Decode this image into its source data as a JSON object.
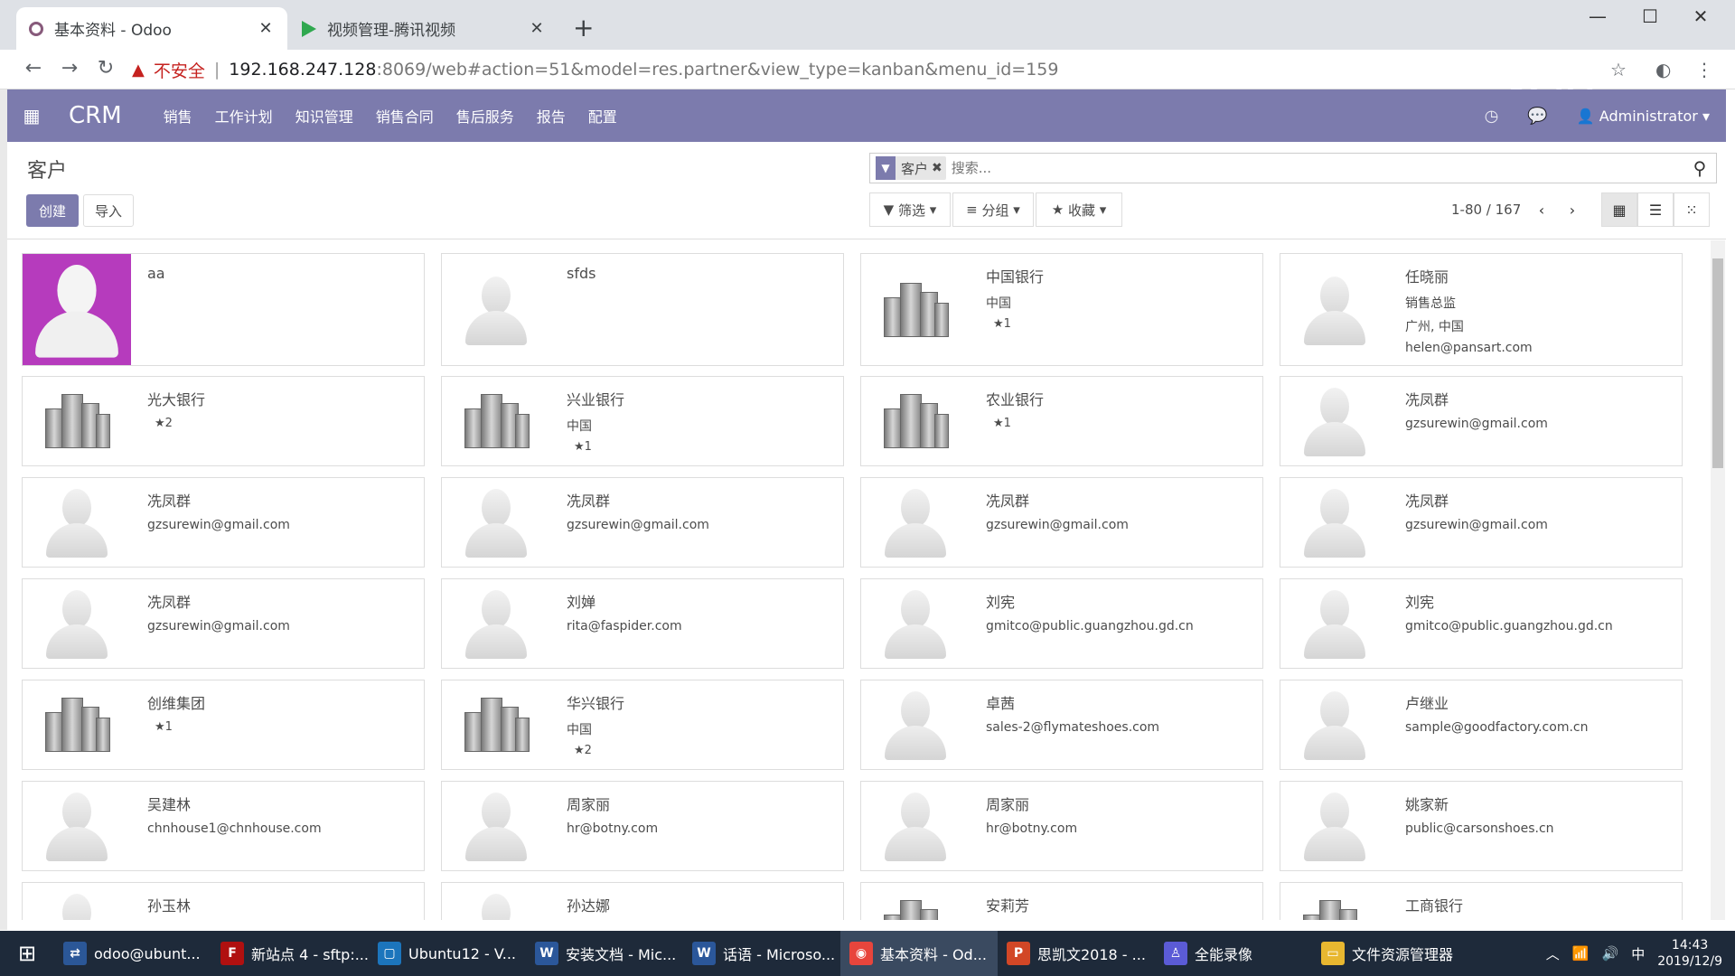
{
  "browser": {
    "tabs": [
      {
        "title": "基本资料 - Odoo",
        "close": "✕"
      },
      {
        "title": "视频管理-腾讯视频",
        "close": "✕"
      }
    ],
    "new_tab": "+",
    "security_warning": "不安全",
    "url_host": "192.168.247.128",
    "url_rest": ":8069/web#action=51&model=res.partner&view_type=kanban&menu_id=159",
    "watermark": "爱拍"
  },
  "app": {
    "brand": "CRM",
    "menu": [
      "销售",
      "工作计划",
      "知识管理",
      "销售合同",
      "售后服务",
      "报告",
      "配置"
    ],
    "user": "Administrator"
  },
  "control_panel": {
    "breadcrumb": "客户",
    "create_label": "创建",
    "import_label": "导入",
    "facet_label": "客户",
    "search_placeholder": "搜索...",
    "filter_label": "筛选",
    "group_label": "分组",
    "favorites_label": "收藏",
    "pager": "1-80 / 167"
  },
  "cards": [
    {
      "name": "aa",
      "lines": [],
      "type": "photo"
    },
    {
      "name": "sfds",
      "lines": [],
      "type": "person"
    },
    {
      "name": "中国银行",
      "lines": [
        "中国"
      ],
      "stars": "1",
      "type": "company"
    },
    {
      "name": "任晓丽",
      "lines": [
        "销售总监",
        "广州, 中国",
        "helen@pansart.com"
      ],
      "type": "person"
    },
    {
      "name": "光大银行",
      "lines": [],
      "stars": "2",
      "type": "company"
    },
    {
      "name": "兴业银行",
      "lines": [
        "中国"
      ],
      "stars": "1",
      "type": "company"
    },
    {
      "name": "农业银行",
      "lines": [],
      "stars": "1",
      "type": "company"
    },
    {
      "name": "冼凤群",
      "lines": [
        "gzsurewin@gmail.com"
      ],
      "type": "person"
    },
    {
      "name": "冼凤群",
      "lines": [
        "gzsurewin@gmail.com"
      ],
      "type": "person"
    },
    {
      "name": "冼凤群",
      "lines": [
        "gzsurewin@gmail.com"
      ],
      "type": "person"
    },
    {
      "name": "冼凤群",
      "lines": [
        "gzsurewin@gmail.com"
      ],
      "type": "person"
    },
    {
      "name": "冼凤群",
      "lines": [
        "gzsurewin@gmail.com"
      ],
      "type": "person"
    },
    {
      "name": "冼凤群",
      "lines": [
        "gzsurewin@gmail.com"
      ],
      "type": "person"
    },
    {
      "name": "刘婵",
      "lines": [
        "rita@faspider.com"
      ],
      "type": "person"
    },
    {
      "name": "刘宪",
      "lines": [
        "gmitco@public.guangzhou.gd.cn"
      ],
      "type": "person"
    },
    {
      "name": "刘宪",
      "lines": [
        "gmitco@public.guangzhou.gd.cn"
      ],
      "type": "person"
    },
    {
      "name": "创维集团",
      "lines": [],
      "stars": "1",
      "type": "company"
    },
    {
      "name": "华兴银行",
      "lines": [
        "中国"
      ],
      "stars": "2",
      "type": "company"
    },
    {
      "name": "卓茜",
      "lines": [
        "sales-2@flymateshoes.com"
      ],
      "type": "person"
    },
    {
      "name": "卢继业",
      "lines": [
        "sample@goodfactory.com.cn"
      ],
      "type": "person"
    },
    {
      "name": "吴建林",
      "lines": [
        "chnhouse1@chnhouse.com"
      ],
      "type": "person"
    },
    {
      "name": "周家丽",
      "lines": [
        "hr@botny.com"
      ],
      "type": "person"
    },
    {
      "name": "周家丽",
      "lines": [
        "hr@botny.com"
      ],
      "type": "person"
    },
    {
      "name": "姚家新",
      "lines": [
        "public@carsonshoes.cn"
      ],
      "type": "person"
    },
    {
      "name": "孙玉林",
      "lines": [],
      "type": "person"
    },
    {
      "name": "孙达娜",
      "lines": [],
      "type": "person"
    },
    {
      "name": "安莉芳",
      "lines": [],
      "type": "company"
    },
    {
      "name": "工商银行",
      "lines": [],
      "type": "company"
    }
  ],
  "taskbar": {
    "items": [
      {
        "label": "odoo@ubunt...",
        "color": "#2b5797",
        "glyph": "⇄"
      },
      {
        "label": "新站点 4 - sftp:...",
        "color": "#b01010",
        "glyph": "F"
      },
      {
        "label": "Ubuntu12 - V...",
        "color": "#1c75bc",
        "glyph": "▢"
      },
      {
        "label": "安装文档 - Mic...",
        "color": "#2b579a",
        "glyph": "W"
      },
      {
        "label": "话语 - Microso...",
        "color": "#2b579a",
        "glyph": "W"
      },
      {
        "label": "基本资料 - Od...",
        "color": "#e8453c",
        "glyph": "◉"
      },
      {
        "label": "思凯文2018 - ...",
        "color": "#d24726",
        "glyph": "P"
      },
      {
        "label": "全能录像",
        "color": "#5b5bd6",
        "glyph": "♙"
      },
      {
        "label": "文件资源管理器",
        "color": "#e8b730",
        "glyph": "▭"
      }
    ],
    "ime": "中",
    "time": "14:43",
    "date": "2019/12/9"
  },
  "colors": {
    "brand": "#7c7bad",
    "photo_bg": "#b63bbd"
  }
}
